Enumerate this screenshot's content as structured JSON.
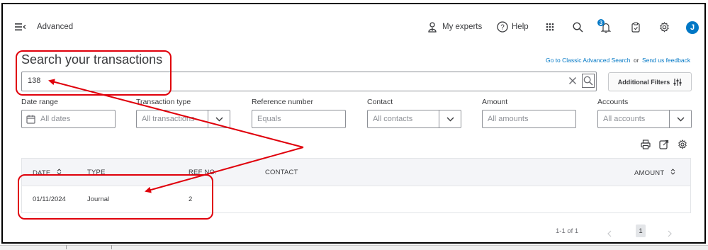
{
  "header": {
    "app_label": "Advanced",
    "my_experts_label": "My experts",
    "help_label": "Help",
    "notification_count": "3",
    "avatar_initial": "J"
  },
  "search": {
    "title": "Search your transactions",
    "query_value": "138",
    "classic_link": "Go to Classic Advanced Search",
    "or_text": "or",
    "feedback_link": "Send us feedback",
    "additional_filters_label": "Additional Filters"
  },
  "filters": {
    "date_range": {
      "label": "Date range",
      "placeholder": "All dates"
    },
    "transaction_type": {
      "label": "Transaction type",
      "placeholder": "All transactions"
    },
    "reference_number": {
      "label": "Reference number",
      "placeholder": "Equals"
    },
    "contact": {
      "label": "Contact",
      "placeholder": "All contacts"
    },
    "amount": {
      "label": "Amount",
      "placeholder": "All amounts"
    },
    "accounts": {
      "label": "Accounts",
      "placeholder": "All accounts"
    }
  },
  "table": {
    "columns": {
      "date": "DATE",
      "type": "TYPE",
      "ref_no": "REF NO.",
      "contact": "CONTACT",
      "amount": "AMOUNT"
    },
    "rows": [
      {
        "date": "01/11/2024",
        "type": "Journal",
        "ref_no": "2",
        "contact": "",
        "amount": ""
      }
    ]
  },
  "pagination": {
    "range_text": "1-1 of 1",
    "current_page": "1"
  },
  "colors": {
    "accent": "#0077c5",
    "annotation_red": "#e0000b"
  }
}
